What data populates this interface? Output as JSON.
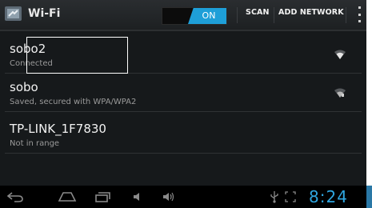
{
  "actionbar": {
    "title": "Wi-Fi",
    "toggle_label": "ON",
    "scan_label": "SCAN",
    "add_network_label": "ADD NETWORK",
    "app_icon": "settings-app-icon"
  },
  "networks": [
    {
      "name": "sobo2",
      "status": "Connected",
      "signal_icon": "wifi-signal-icon"
    },
    {
      "name": "sobo",
      "status": "Saved, secured with WPA/WPA2",
      "signal_icon": "wifi-signal-icon"
    },
    {
      "name": "TP-LINK_1F7830",
      "status": "Not in range"
    }
  ],
  "navbar": {
    "icons": [
      "back-icon",
      "home-icon",
      "recent-apps-icon",
      "volume-down-icon",
      "volume-up-icon",
      "usb-icon",
      "screenshot-icon"
    ],
    "clock": "8:24"
  },
  "colors": {
    "accent": "#1e9fd8",
    "clock": "#2fa6e0",
    "background": "#16191b"
  }
}
